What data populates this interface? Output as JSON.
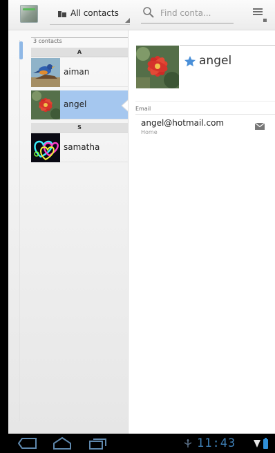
{
  "header": {
    "filter_label": "All contacts",
    "search_placeholder": "Find conta..."
  },
  "list": {
    "count": "3 contacts",
    "sections": [
      {
        "letter": "A"
      },
      {
        "letter": "S"
      }
    ],
    "contacts": [
      {
        "name": "aiman",
        "avatar": "bird-photo"
      },
      {
        "name": "angel",
        "avatar": "red-flower-photo",
        "selected": true
      },
      {
        "name": "samatha",
        "avatar": "neon-hearts-photo"
      }
    ]
  },
  "detail": {
    "name": "angel",
    "starred": true,
    "email_section_label": "Email",
    "email": "angel@hotmail.com",
    "email_type": "Home"
  },
  "status_bar": {
    "time": "11:43"
  },
  "colors": {
    "selection": "#a5c7ef",
    "star": "#4a8fd8",
    "clock": "#3e7fb5"
  }
}
